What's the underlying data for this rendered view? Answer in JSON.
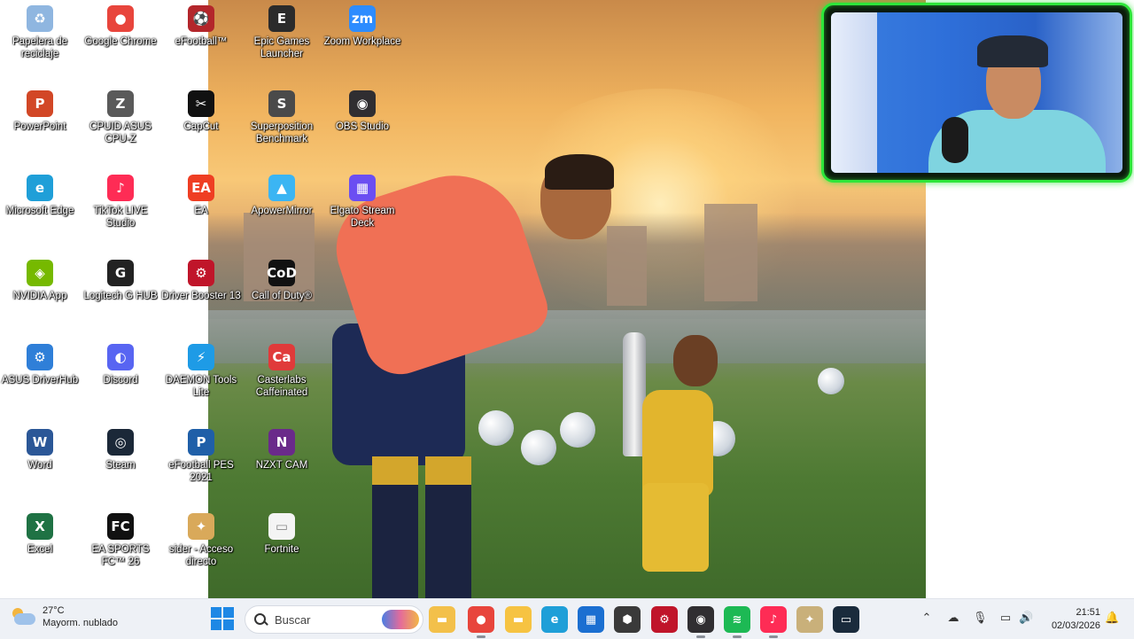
{
  "desktop": {
    "icons": [
      {
        "label": "Papelera de reciclaje",
        "glyph": "♻",
        "color": "#8fb6e0",
        "col": 0,
        "row": 0
      },
      {
        "label": "Google Chrome",
        "glyph": "●",
        "color": "#e8453c",
        "col": 1,
        "row": 0
      },
      {
        "label": "eFootball™",
        "glyph": "⚽",
        "color": "#b3262b",
        "col": 2,
        "row": 0
      },
      {
        "label": "Epic Games Launcher",
        "glyph": "E",
        "color": "#2b2b2b",
        "col": 3,
        "row": 0
      },
      {
        "label": "Zoom Workplace",
        "glyph": "zm",
        "color": "#2d8cff",
        "col": 4,
        "row": 0
      },
      {
        "label": "PowerPoint",
        "glyph": "P",
        "color": "#d24726",
        "col": 0,
        "row": 1
      },
      {
        "label": "CPUID ASUS CPU-Z",
        "glyph": "Z",
        "color": "#5a5a5a",
        "col": 1,
        "row": 1
      },
      {
        "label": "CapCut",
        "glyph": "✂",
        "color": "#111111",
        "col": 2,
        "row": 1
      },
      {
        "label": "Superposition Benchmark",
        "glyph": "S",
        "color": "#4a4a4a",
        "col": 3,
        "row": 1
      },
      {
        "label": "OBS Studio",
        "glyph": "◉",
        "color": "#302e31",
        "col": 4,
        "row": 1
      },
      {
        "label": "Microsoft Edge",
        "glyph": "e",
        "color": "#1f9fd8",
        "col": 0,
        "row": 2
      },
      {
        "label": "TikTok LIVE Studio",
        "glyph": "♪",
        "color": "#fe2c55",
        "col": 1,
        "row": 2
      },
      {
        "label": "EA",
        "glyph": "EA",
        "color": "#ef3e23",
        "col": 2,
        "row": 2
      },
      {
        "label": "ApowerMirror",
        "glyph": "▲",
        "color": "#3bb5f3",
        "col": 3,
        "row": 2
      },
      {
        "label": "Elgato Stream Deck",
        "glyph": "▦",
        "color": "#6b4ef2",
        "col": 4,
        "row": 2
      },
      {
        "label": "NVIDIA App",
        "glyph": "◈",
        "color": "#76b900",
        "col": 0,
        "row": 3
      },
      {
        "label": "Logitech G HUB",
        "glyph": "G",
        "color": "#222222",
        "col": 1,
        "row": 3
      },
      {
        "label": "Driver Booster 13",
        "glyph": "⚙",
        "color": "#c0152a",
        "col": 2,
        "row": 3
      },
      {
        "label": "Call of Duty®",
        "glyph": "CoD",
        "color": "#111111",
        "col": 3,
        "row": 3
      },
      {
        "label": "ASUS DriverHub",
        "glyph": "⚙",
        "color": "#2f7fd8",
        "col": 0,
        "row": 4
      },
      {
        "label": "Discord",
        "glyph": "◐",
        "color": "#5865f2",
        "col": 1,
        "row": 4
      },
      {
        "label": "DAEMON Tools Lite",
        "glyph": "⚡",
        "color": "#1e9be6",
        "col": 2,
        "row": 4
      },
      {
        "label": "Casterlabs Caffeinated",
        "glyph": "Ca",
        "color": "#e03a3a",
        "col": 3,
        "row": 4
      },
      {
        "label": "Word",
        "glyph": "W",
        "color": "#2b5797",
        "col": 0,
        "row": 5
      },
      {
        "label": "Steam",
        "glyph": "◎",
        "color": "#1b2838",
        "col": 1,
        "row": 5
      },
      {
        "label": "eFootball PES 2021",
        "glyph": "P",
        "color": "#1f5fa8",
        "col": 2,
        "row": 5
      },
      {
        "label": "NZXT CAM",
        "glyph": "N",
        "color": "#6a2a8a",
        "col": 3,
        "row": 5
      },
      {
        "label": "Excel",
        "glyph": "X",
        "color": "#1f7244",
        "col": 0,
        "row": 6
      },
      {
        "label": "EA SPORTS FC™ 26",
        "glyph": "FC",
        "color": "#111111",
        "col": 1,
        "row": 6
      },
      {
        "label": "sider - Acceso directo",
        "glyph": "✦",
        "color": "#d9a95a",
        "col": 2,
        "row": 6
      },
      {
        "label": "Fortnite",
        "glyph": "▭",
        "color": "#f4f4f4",
        "col": 3,
        "row": 6
      }
    ]
  },
  "taskbar": {
    "weather_temp": "27°C",
    "weather_desc": "Mayorm. nublado",
    "search_placeholder": "Buscar",
    "apps": [
      {
        "name": "file-explorer-taskbar",
        "glyph": "▬",
        "color": "#f3c04a"
      },
      {
        "name": "chrome-taskbar",
        "glyph": "●",
        "color": "#e8453c"
      },
      {
        "name": "folder-taskbar",
        "glyph": "▬",
        "color": "#f6c342"
      },
      {
        "name": "edge-taskbar",
        "glyph": "e",
        "color": "#1f9fd8"
      },
      {
        "name": "store-taskbar",
        "glyph": "▦",
        "color": "#1b6fd1"
      },
      {
        "name": "app-cube-taskbar",
        "glyph": "⬢",
        "color": "#3a3a3a"
      },
      {
        "name": "driver-booster-taskbar",
        "glyph": "⚙",
        "color": "#c0152a"
      },
      {
        "name": "obs-taskbar",
        "glyph": "◉",
        "color": "#302e31"
      },
      {
        "name": "spotify-taskbar",
        "glyph": "≋",
        "color": "#1db954"
      },
      {
        "name": "tiktok-taskbar",
        "glyph": "♪",
        "color": "#fe2c55"
      },
      {
        "name": "tools-taskbar",
        "glyph": "✦",
        "color": "#c9b07a"
      },
      {
        "name": "stream-app-taskbar",
        "glyph": "▭",
        "color": "#1a2b3c"
      }
    ],
    "clock_time": "21:51",
    "clock_date": "02/03/2026"
  }
}
